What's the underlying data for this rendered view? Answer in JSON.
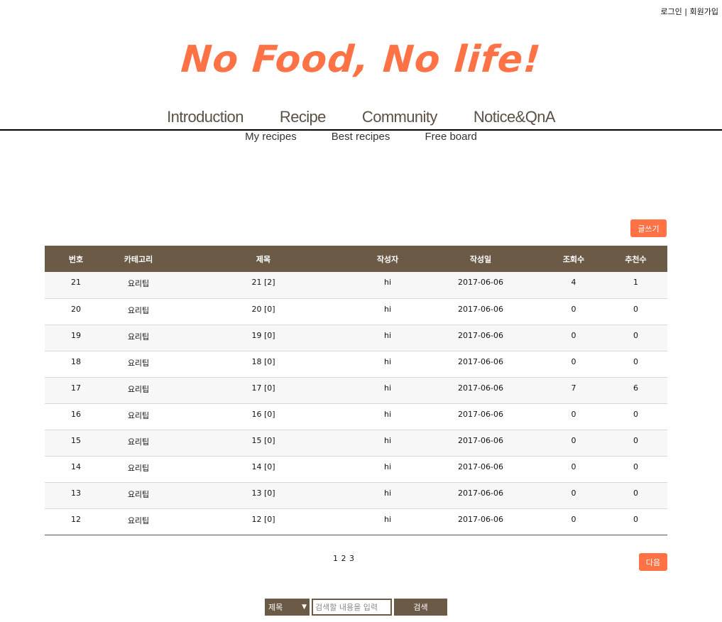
{
  "auth": {
    "login": "로그인",
    "separator": " | ",
    "signup": "회원가입"
  },
  "logo": "No Food, No life!",
  "nav": {
    "main": [
      "Introduction",
      "Recipe",
      "Community",
      "Notice&QnA"
    ],
    "sub": [
      "My recipes",
      "Best recipes",
      "Free board"
    ]
  },
  "write_button": "글쓰기",
  "table": {
    "headers": [
      "번호",
      "카테고리",
      "제목",
      "작성자",
      "작성일",
      "조회수",
      "추천수"
    ],
    "rows": [
      [
        "21",
        "요리팁",
        "21 [2]",
        "hi",
        "2017-06-06",
        "4",
        "1"
      ],
      [
        "20",
        "요리팁",
        "20 [0]",
        "hi",
        "2017-06-06",
        "0",
        "0"
      ],
      [
        "19",
        "요리팁",
        "19 [0]",
        "hi",
        "2017-06-06",
        "0",
        "0"
      ],
      [
        "18",
        "요리팁",
        "18 [0]",
        "hi",
        "2017-06-06",
        "0",
        "0"
      ],
      [
        "17",
        "요리팁",
        "17 [0]",
        "hi",
        "2017-06-06",
        "7",
        "6"
      ],
      [
        "16",
        "요리팁",
        "16 [0]",
        "hi",
        "2017-06-06",
        "0",
        "0"
      ],
      [
        "15",
        "요리팁",
        "15 [0]",
        "hi",
        "2017-06-06",
        "0",
        "0"
      ],
      [
        "14",
        "요리팁",
        "14 [0]",
        "hi",
        "2017-06-06",
        "0",
        "0"
      ],
      [
        "13",
        "요리팁",
        "13 [0]",
        "hi",
        "2017-06-06",
        "0",
        "0"
      ],
      [
        "12",
        "요리팁",
        "12 [0]",
        "hi",
        "2017-06-06",
        "0",
        "0"
      ]
    ]
  },
  "pagination": {
    "pages": [
      "1",
      "2",
      "3"
    ]
  },
  "next_button": "다음",
  "search": {
    "select_value": "제목",
    "placeholder": "검색할 내용을 입력",
    "button": "검색"
  },
  "colors": {
    "accent": "#ff7246",
    "brown": "#6b5a46"
  }
}
